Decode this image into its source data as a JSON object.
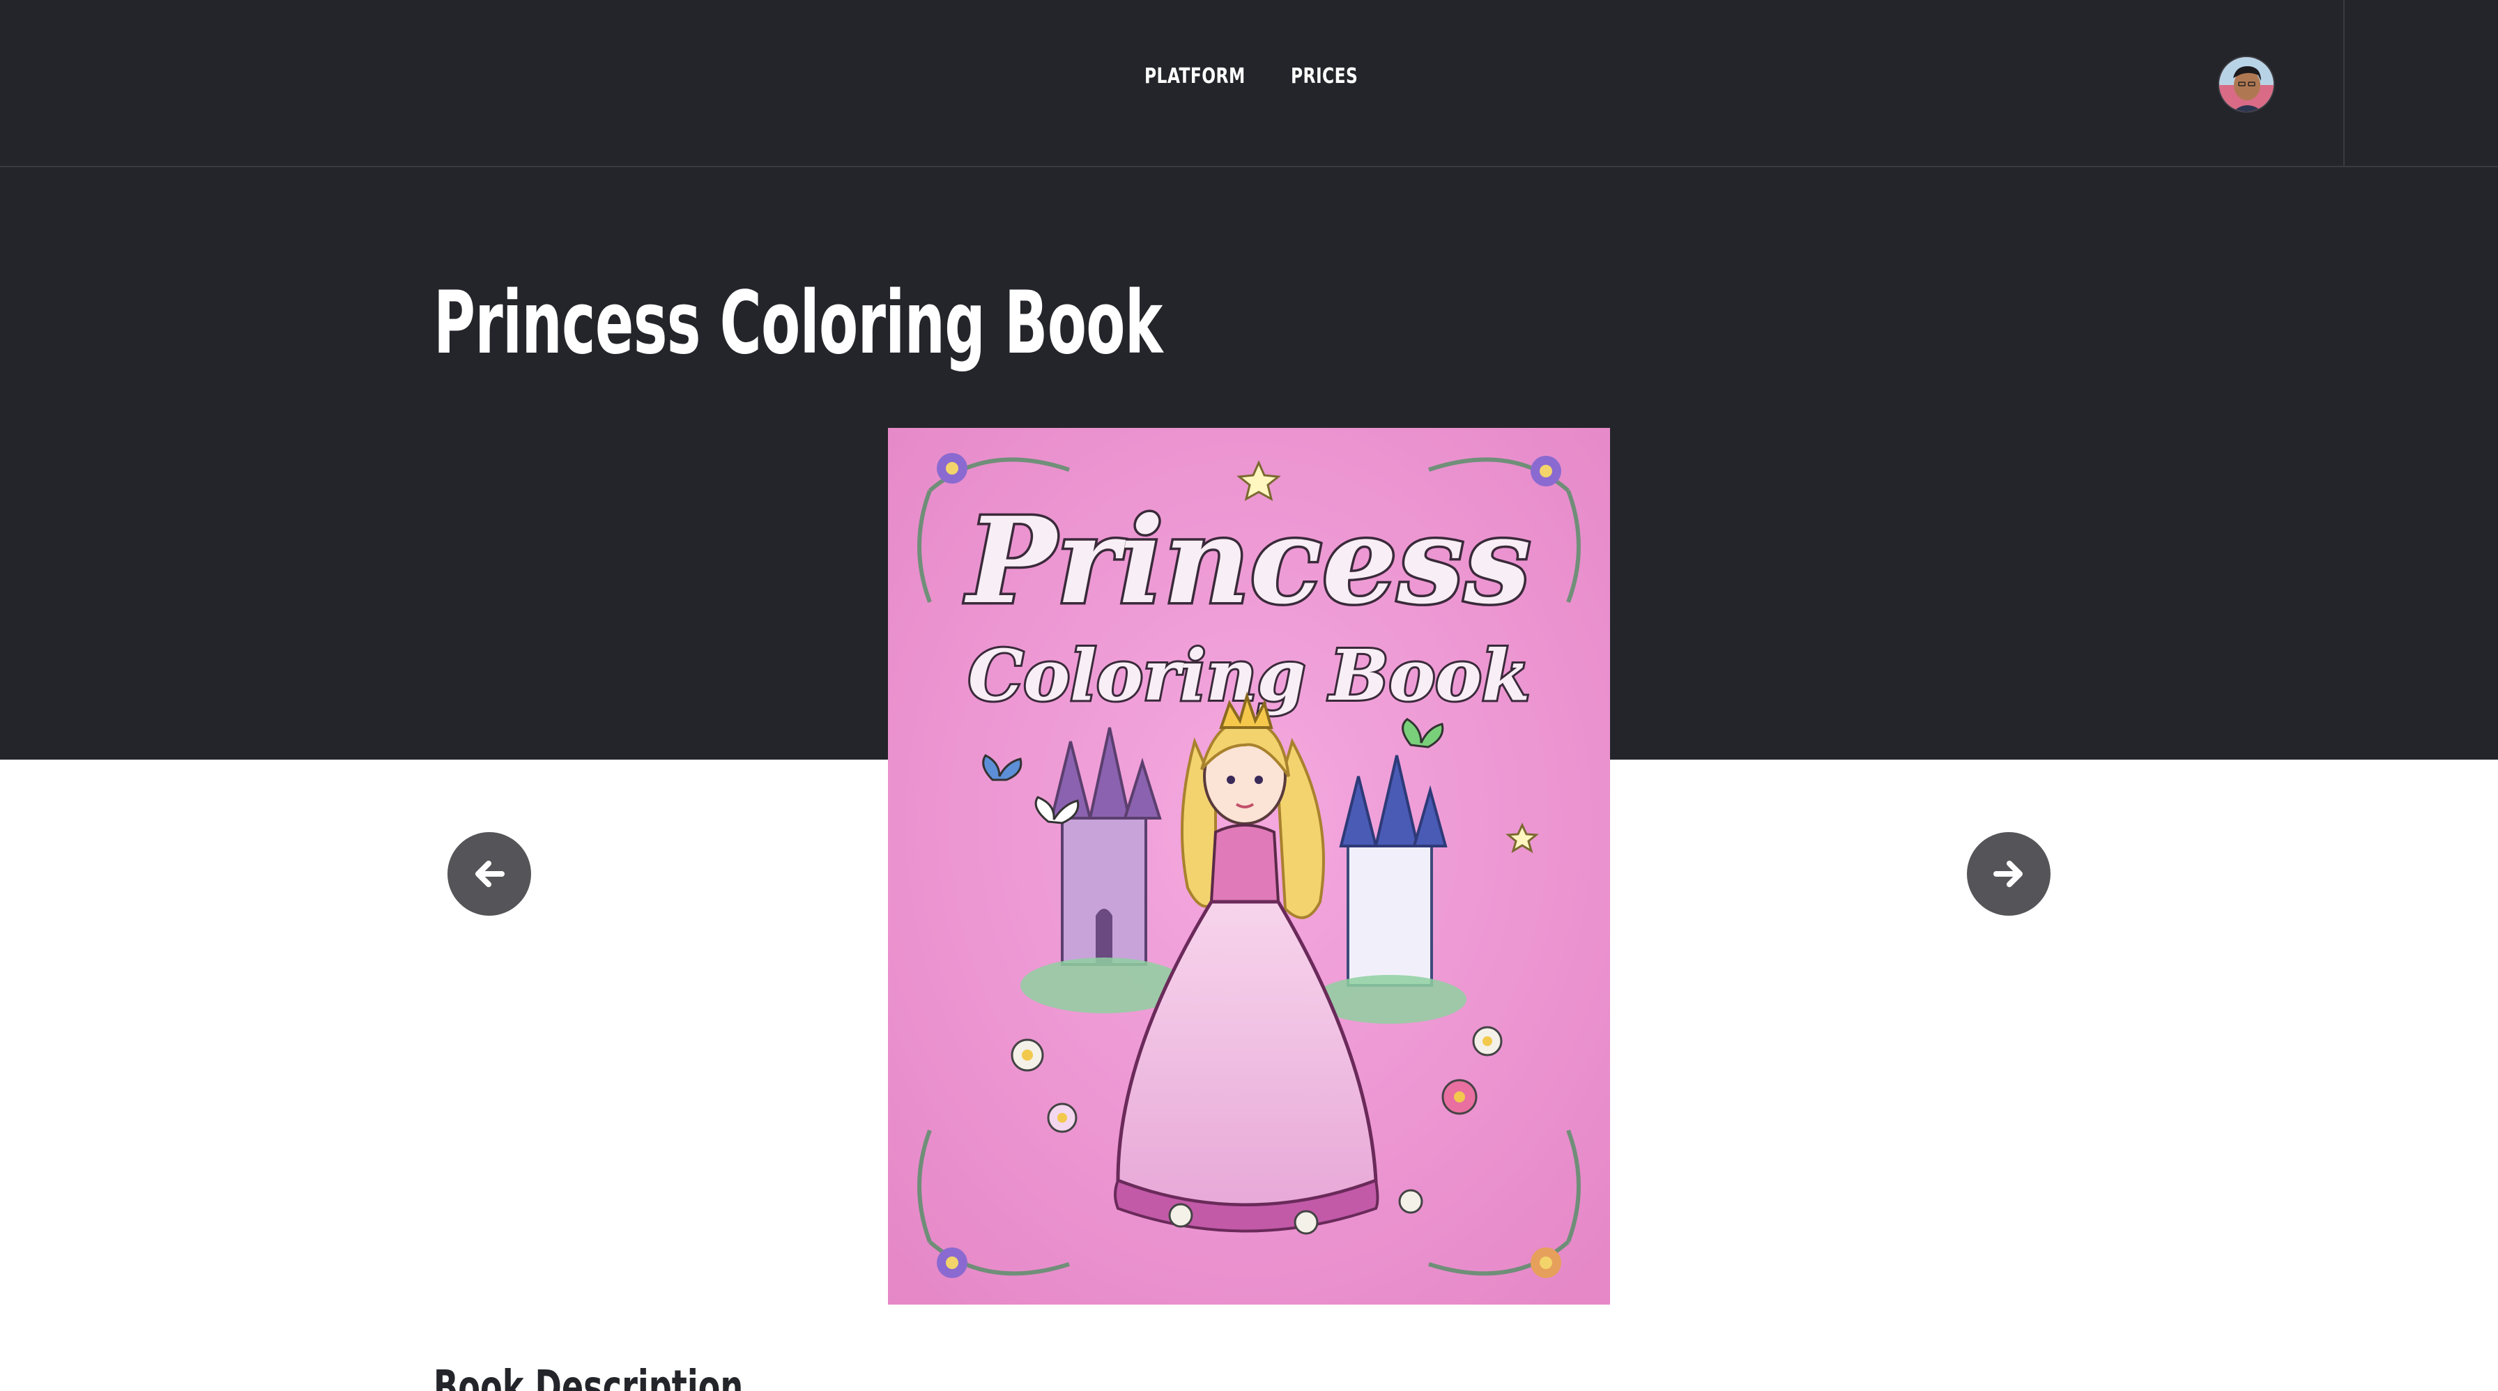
{
  "header": {
    "nav": [
      {
        "label": "PLATFORM"
      },
      {
        "label": "PRICES"
      }
    ]
  },
  "main": {
    "title": "Princess Coloring Book",
    "section_heading": "Book Description",
    "cover": {
      "title_line1": "Princess",
      "title_line2": "Coloring Book"
    }
  },
  "colors": {
    "dark_background": "#24252a",
    "cover_pink": "#ea96d2",
    "arrow_button": "#555559"
  },
  "icons": {
    "prev": "arrow-left-icon",
    "next": "arrow-right-icon",
    "avatar": "user-avatar"
  }
}
